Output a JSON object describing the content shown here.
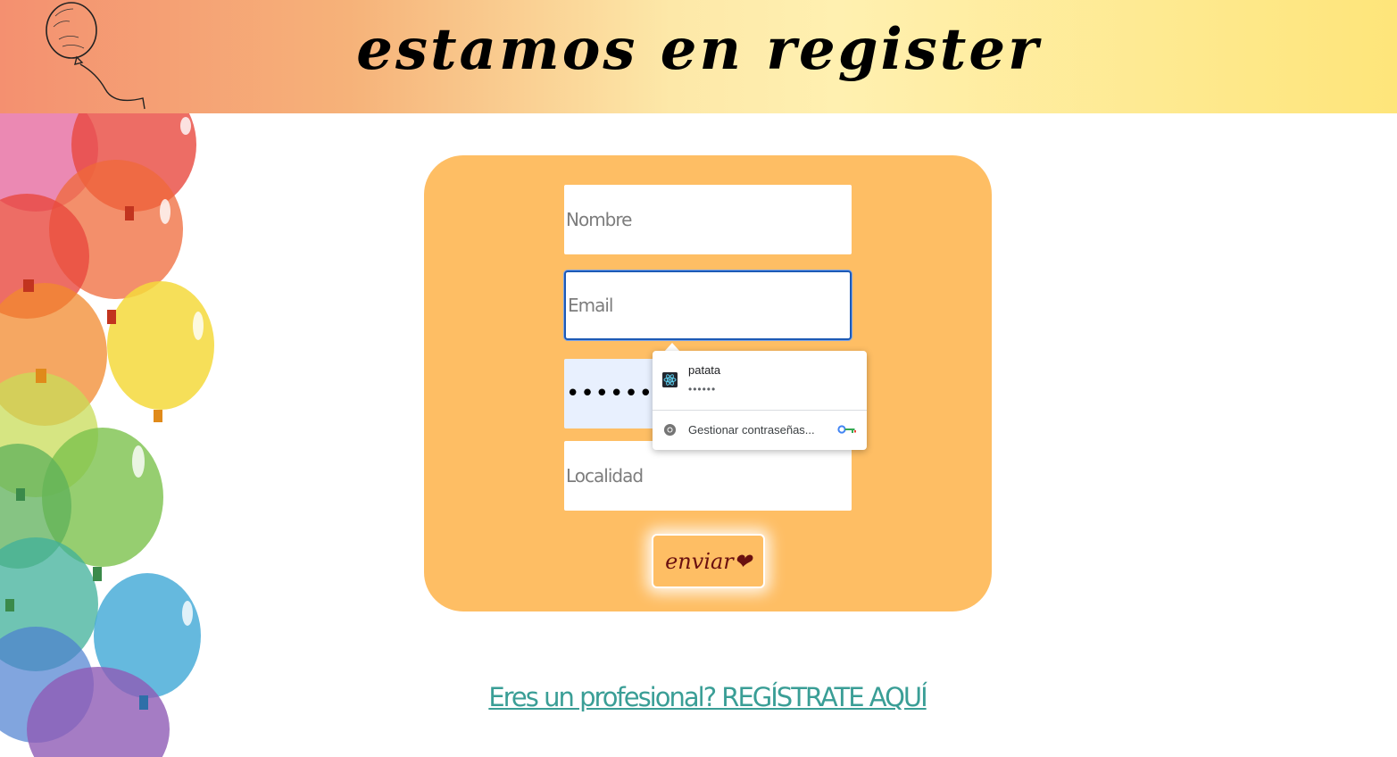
{
  "header": {
    "title": "estamos en register",
    "logo_icon": "balloon-icon"
  },
  "decoration": {
    "icon": "balloons-decoration",
    "colors": [
      "#e8493f",
      "#f28a2e",
      "#f4d93c",
      "#7cc24c",
      "#3fa7d6",
      "#8f5bb5",
      "#e4629a"
    ]
  },
  "form": {
    "nombre_placeholder": "Nombre",
    "email_placeholder": "Email",
    "password_value": "••••••",
    "localidad_placeholder": "Localidad",
    "submit_label": "enviar❤"
  },
  "autofill": {
    "credential_username": "patata",
    "credential_password": "••••••",
    "credential_icon": "react-icon",
    "manage_label": "Gestionar contraseñas...",
    "manage_icon": "chrome-icon",
    "key_icon": "google-key-icon"
  },
  "footer": {
    "pro_link": "Eres un profesional? REGÍSTRATE AQUÍ"
  },
  "colors": {
    "card_bg": "#febe64",
    "link": "#3a9e96",
    "focus_border": "#1d5ab5",
    "autofill_bg": "#e8f0fe"
  }
}
